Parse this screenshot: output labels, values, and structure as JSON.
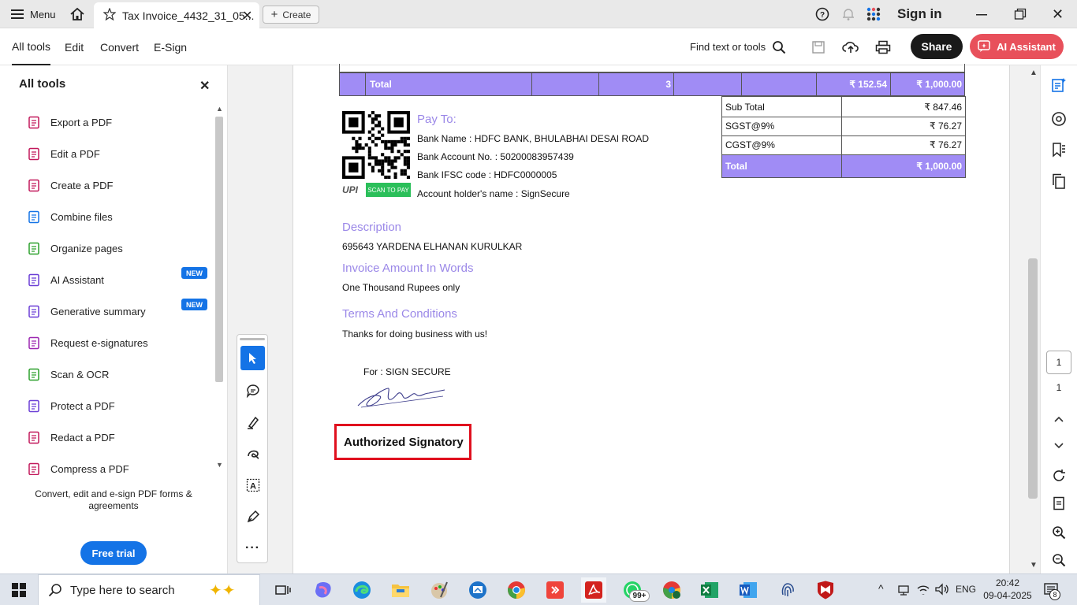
{
  "titlebar": {
    "menu_label": "Menu",
    "tab_title": "Tax Invoice_4432_31_05...",
    "create_label": "Create",
    "sign_in": "Sign in"
  },
  "toolbar": {
    "tabs": [
      "All tools",
      "Edit",
      "Convert",
      "E-Sign"
    ],
    "find_label": "Find text or tools",
    "share_label": "Share",
    "ai_label": "AI Assistant"
  },
  "left_panel": {
    "title": "All tools",
    "tools": [
      {
        "label": "Export a PDF",
        "icon": "export-pdf-icon",
        "badge": ""
      },
      {
        "label": "Edit a PDF",
        "icon": "edit-pdf-icon",
        "badge": ""
      },
      {
        "label": "Create a PDF",
        "icon": "create-pdf-icon",
        "badge": ""
      },
      {
        "label": "Combine files",
        "icon": "combine-files-icon",
        "badge": ""
      },
      {
        "label": "Organize pages",
        "icon": "organize-pages-icon",
        "badge": ""
      },
      {
        "label": "AI Assistant",
        "icon": "ai-assistant-icon",
        "badge": "NEW"
      },
      {
        "label": "Generative summary",
        "icon": "generative-summary-icon",
        "badge": "NEW"
      },
      {
        "label": "Request e-signatures",
        "icon": "request-esign-icon",
        "badge": ""
      },
      {
        "label": "Scan & OCR",
        "icon": "scan-ocr-icon",
        "badge": ""
      },
      {
        "label": "Protect a PDF",
        "icon": "protect-pdf-icon",
        "badge": ""
      },
      {
        "label": "Redact a PDF",
        "icon": "redact-pdf-icon",
        "badge": ""
      },
      {
        "label": "Compress a PDF",
        "icon": "compress-pdf-icon",
        "badge": ""
      }
    ],
    "footer_text": "Convert, edit and e-sign PDF forms & agreements",
    "trial_label": "Free trial"
  },
  "invoice": {
    "items_total_row": {
      "label": "Total",
      "qty": "3",
      "tax": "₹ 152.54",
      "amount": "₹ 1,000.00"
    },
    "summary": [
      {
        "label": "Sub Total",
        "value": "₹ 847.46"
      },
      {
        "label": "SGST@9%",
        "value": "₹ 76.27"
      },
      {
        "label": "CGST@9%",
        "value": "₹ 76.27"
      },
      {
        "label": "Total",
        "value": "₹ 1,000.00"
      }
    ],
    "pay_to_heading": "Pay To:",
    "bank_lines": [
      "Bank Name : HDFC BANK, BHULABHAI DESAI ROAD",
      "Bank Account No. : 50200083957439",
      "Bank IFSC code : HDFC0000005",
      "Account holder's name : SignSecure"
    ],
    "upi_label": "UPI",
    "scan_to_pay": "SCAN TO PAY",
    "description_heading": "Description",
    "description_text": "695643 YARDENA ELHANAN KURULKAR",
    "amount_words_heading": "Invoice Amount In Words",
    "amount_words_text": "One Thousand Rupees only",
    "terms_heading": "Terms And Conditions",
    "terms_text": "Thanks for doing business with us!",
    "for_label": "For : SIGN SECURE",
    "signatory_label": "Authorized Signatory"
  },
  "right_rail": {
    "page_current": "1",
    "page_total": "1"
  },
  "taskbar": {
    "search_placeholder": "Type here to search",
    "whatsapp_badge": "99+",
    "language": "ENG",
    "time": "20:42",
    "date": "09-04-2025",
    "notification_count": "8"
  },
  "colors": {
    "accent_blue": "#1473e6",
    "table_purple": "#a08cf5",
    "heading_purple": "#9b88e8",
    "ai_button": "#e8505b",
    "highlight_red": "#e0101e"
  }
}
